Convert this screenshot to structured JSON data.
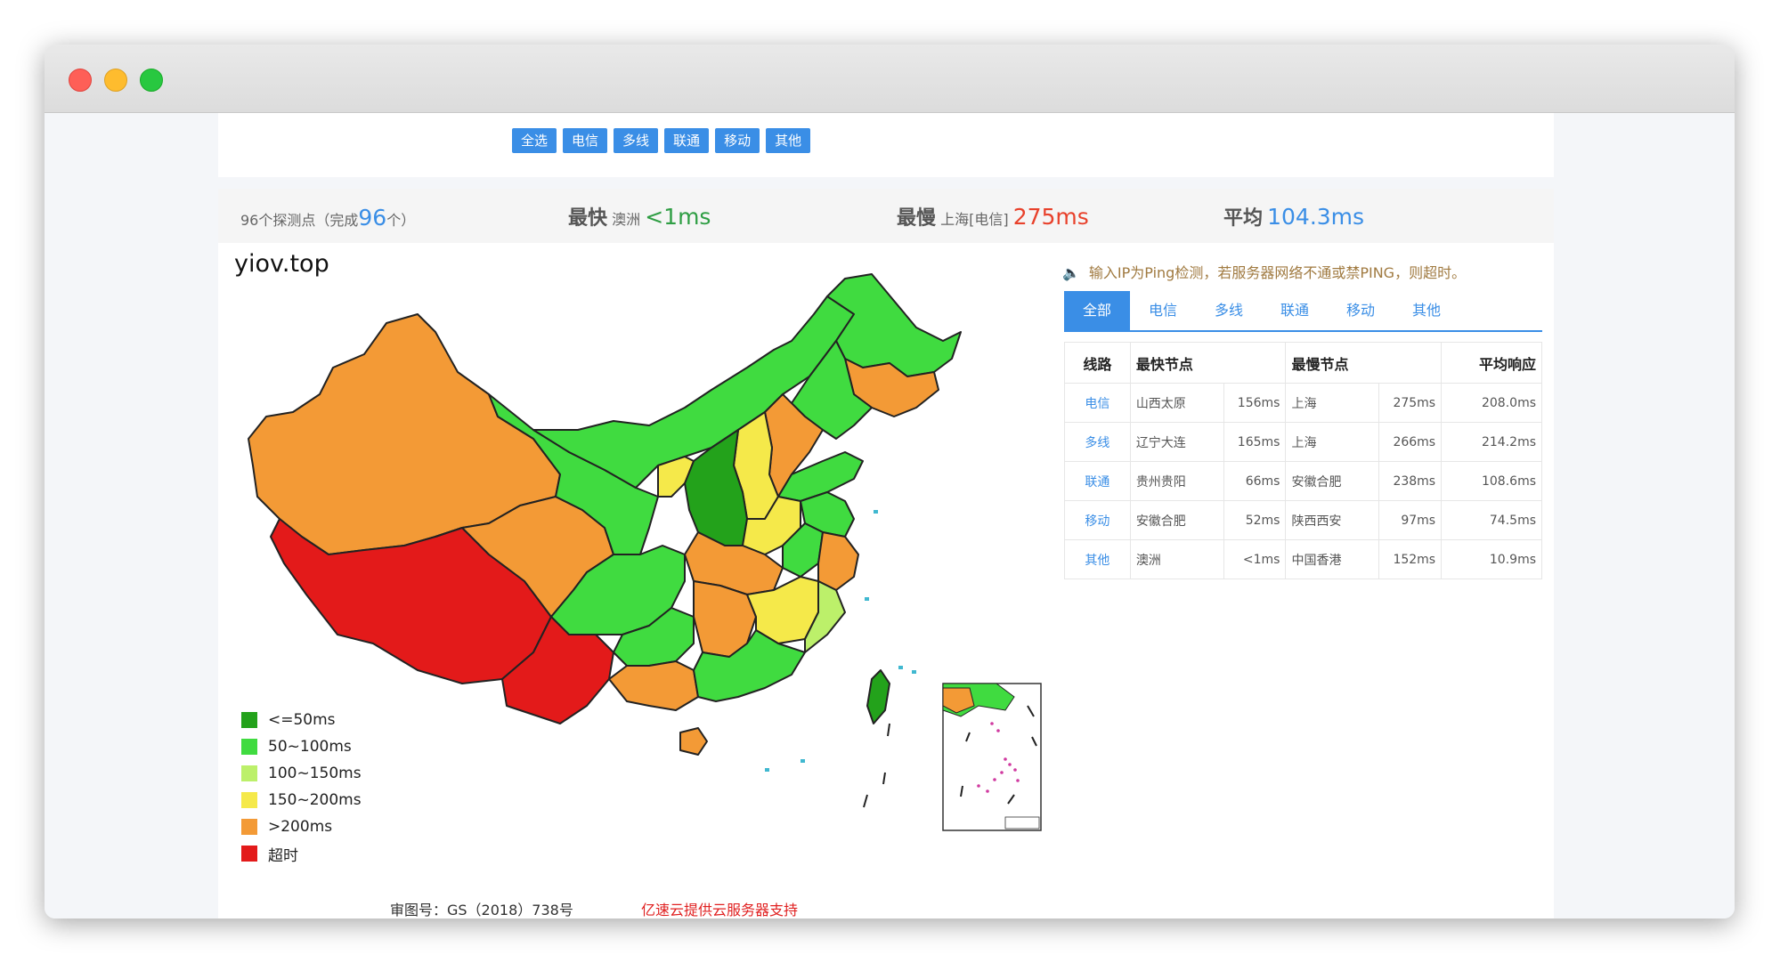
{
  "filters": [
    "全选",
    "电信",
    "多线",
    "联通",
    "移动",
    "其他"
  ],
  "stats": {
    "probe_prefix": "96个探测点（完成",
    "probe_done": "96",
    "probe_suffix": "个）",
    "fastest_label": "最快",
    "fastest_node": "澳洲",
    "fastest_value": "<1ms",
    "slowest_label": "最慢",
    "slowest_node": "上海[电信]",
    "slowest_value": "275ms",
    "avg_label": "平均",
    "avg_value": "104.3ms"
  },
  "map": {
    "title": "yiov.top",
    "legend": [
      {
        "label": "<=50ms",
        "color": "#23a21b"
      },
      {
        "label": "50~100ms",
        "color": "#40db40"
      },
      {
        "label": "100~150ms",
        "color": "#bcf06a"
      },
      {
        "label": "150~200ms",
        "color": "#f5e94a"
      },
      {
        "label": ">200ms",
        "color": "#f39a36"
      },
      {
        "label": "超时",
        "color": "#e31a1a"
      }
    ],
    "credit": "审图号：GS（2018）738号",
    "sponsor": "亿速云提供云服务器支持"
  },
  "notice": "输入IP为Ping检测，若服务器网络不通或禁PING，则超时。",
  "tabs": [
    "全部",
    "电信",
    "多线",
    "联通",
    "移动",
    "其他"
  ],
  "table": {
    "headers": [
      "线路",
      "最快节点",
      "最慢节点",
      "平均响应"
    ],
    "rows": [
      {
        "line": "电信",
        "fast_node": "山西太原",
        "fast_ms": "156ms",
        "slow_node": "上海",
        "slow_ms": "275ms",
        "avg": "208.0ms"
      },
      {
        "line": "多线",
        "fast_node": "辽宁大连",
        "fast_ms": "165ms",
        "slow_node": "上海",
        "slow_ms": "266ms",
        "avg": "214.2ms"
      },
      {
        "line": "联通",
        "fast_node": "贵州贵阳",
        "fast_ms": "66ms",
        "slow_node": "安徽合肥",
        "slow_ms": "238ms",
        "avg": "108.6ms"
      },
      {
        "line": "移动",
        "fast_node": "安徽合肥",
        "fast_ms": "52ms",
        "slow_node": "陕西西安",
        "slow_ms": "97ms",
        "avg": "74.5ms"
      },
      {
        "line": "其他",
        "fast_node": "澳洲",
        "fast_ms": "<1ms",
        "slow_node": "中国香港",
        "slow_ms": "152ms",
        "avg": "10.9ms"
      }
    ]
  },
  "colors": {
    "accent": "#3a8ee6",
    "fast": "#2f9e44",
    "slow": "#e8412b",
    "avg": "#3a8ee6"
  }
}
